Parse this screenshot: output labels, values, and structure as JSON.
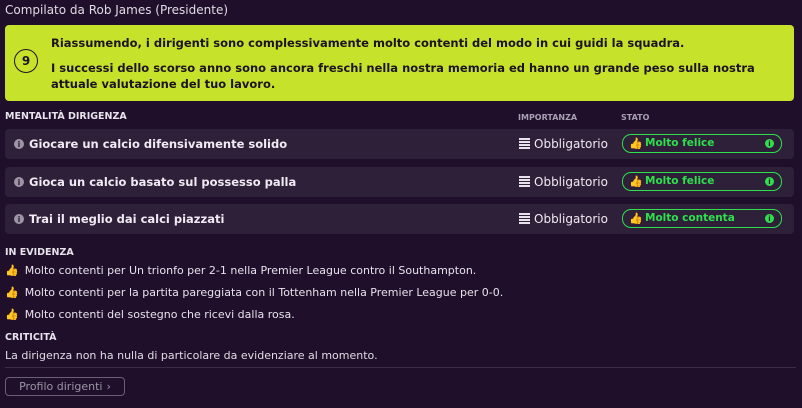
{
  "header": {
    "compiled_by": "Compilato da Rob James (Presidente)"
  },
  "summary": {
    "badge": "9",
    "line1": "Riassumendo, i dirigenti sono complessivamente molto contenti del modo in cui guidi la squadra.",
    "line2": "I successi dello scorso anno sono ancora freschi nella nostra memoria ed hanno un grande peso sulla nostra attuale valutazione del tuo lavoro."
  },
  "columns": {
    "mentality": "MENTALITÀ DIRIGENZA",
    "importance": "IMPORTANZA",
    "status": "STATO"
  },
  "rows": [
    {
      "label": "Giocare un calcio difensivamente solido",
      "importance": "Obbligatorio",
      "status": "Molto felice"
    },
    {
      "label": "Gioca un calcio basato sul possesso palla",
      "importance": "Obbligatorio",
      "status": "Molto felice"
    },
    {
      "label": "Trai il meglio dai calci piazzati",
      "importance": "Obbligatorio",
      "status": "Molto contenta"
    }
  ],
  "highlights": {
    "title": "IN EVIDENZA",
    "items": [
      "Molto contenti per Un trionfo per 2-1 nella Premier League contro il Southampton.",
      "Molto contenti per la partita pareggiata con il Tottenham nella Premier League per 0-0.",
      "Molto contenti del sostegno che ricevi dalla rosa."
    ]
  },
  "criticality": {
    "title": "CRITICITÀ",
    "text": "La dirigenza non ha nulla di particolare da evidenziare al momento."
  },
  "footer": {
    "profile_button": "Profilo dirigenti"
  },
  "colors": {
    "accent": "#c7e22a",
    "positive": "#2fe04d",
    "background": "#1f0f2a",
    "row": "#2e2038"
  },
  "icons": {
    "row_info": "info-icon",
    "importance": "bars-icon",
    "status": "thumbs-up-icon",
    "status_info": "info-icon",
    "button": "chevron-right-icon"
  }
}
